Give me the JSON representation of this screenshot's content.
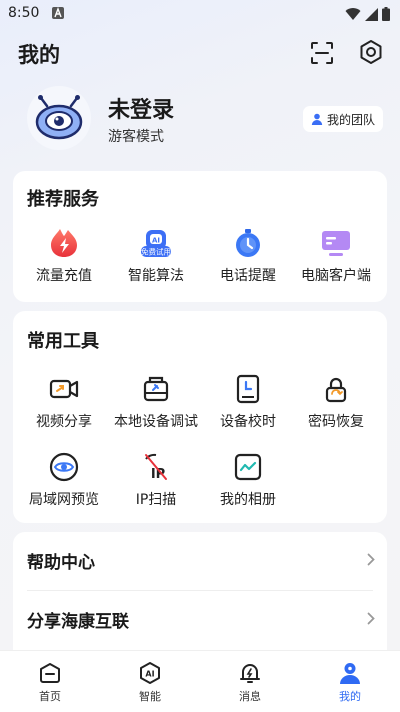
{
  "status": {
    "time": "8:50"
  },
  "header": {
    "title": "我的",
    "scan_icon": "scan-icon",
    "settings_icon": "gear-icon"
  },
  "profile": {
    "title": "未登录",
    "subtitle": "游客模式",
    "team_button": "我的团队"
  },
  "services": {
    "title": "推荐服务",
    "items": [
      {
        "label": "流量充值",
        "icon": "traffic-recharge-icon"
      },
      {
        "label": "智能算法",
        "icon": "ai-algorithm-icon",
        "badge": "免费试用"
      },
      {
        "label": "电话提醒",
        "icon": "phone-reminder-icon"
      },
      {
        "label": "电脑客户端",
        "icon": "pc-client-icon"
      }
    ]
  },
  "tools": {
    "title": "常用工具",
    "items": [
      {
        "label": "视频分享",
        "icon": "video-share-icon"
      },
      {
        "label": "本地设备调试",
        "icon": "device-debug-icon"
      },
      {
        "label": "设备校时",
        "icon": "device-time-icon"
      },
      {
        "label": "密码恢复",
        "icon": "password-reset-icon"
      },
      {
        "label": "局域网预览",
        "icon": "lan-preview-icon"
      },
      {
        "label": "IP扫描",
        "icon": "ip-scan-icon"
      },
      {
        "label": "我的相册",
        "icon": "album-icon"
      }
    ]
  },
  "links": [
    {
      "label": "帮助中心"
    },
    {
      "label": "分享海康互联"
    }
  ],
  "nav": [
    {
      "label": "首页",
      "icon": "home-icon"
    },
    {
      "label": "智能",
      "icon": "ai-icon"
    },
    {
      "label": "消息",
      "icon": "message-icon"
    },
    {
      "label": "我的",
      "icon": "profile-icon",
      "active": true
    }
  ],
  "colors": {
    "accent": "#2f6af3",
    "card": "#ffffff",
    "background": "#f3f4f8"
  }
}
